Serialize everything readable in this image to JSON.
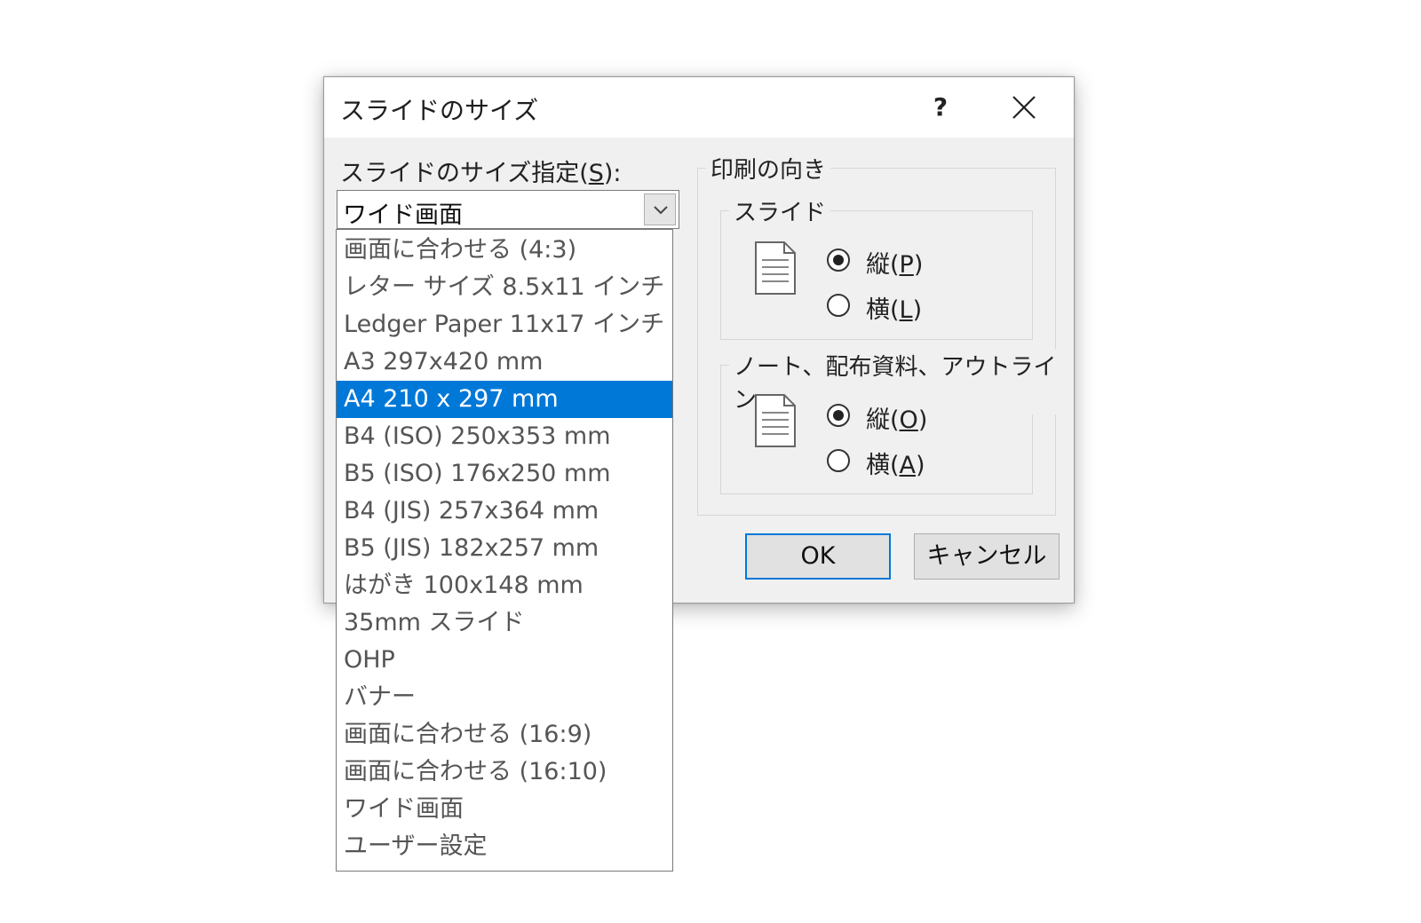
{
  "dialog": {
    "title": "スライドのサイズ",
    "help_label": "?",
    "size_label": {
      "before": "スライドのサイズ指定(",
      "key": "S",
      "after": "):"
    },
    "combo_value": "ワイド画面",
    "orientation_group": "印刷の向き",
    "slide_group": "スライド",
    "slide_portrait": {
      "before": "縦(",
      "key": "P",
      "after": ")"
    },
    "slide_landscape": {
      "before": "横(",
      "key": "L",
      "after": ")"
    },
    "notes_group": "ノート、配布資料、アウトライン",
    "notes_portrait": {
      "before": "縦(",
      "key": "O",
      "after": ")"
    },
    "notes_landscape": {
      "before": "横(",
      "key": "A",
      "after": ")"
    },
    "ok_label": "OK",
    "cancel_label": "キャンセル"
  },
  "dropdown": {
    "selected_index": 4,
    "items": [
      "画面に合わせる (4:3)",
      "レター サイズ 8.5x11 インチ",
      "Ledger Paper 11x17 インチ",
      "A3 297x420 mm",
      "A4 210 x 297 mm",
      "B4 (ISO) 250x353 mm",
      "B5 (ISO) 176x250 mm",
      "B4 (JIS) 257x364 mm",
      "B5 (JIS) 182x257 mm",
      "はがき 100x148 mm",
      "35mm スライド",
      "OHP",
      "バナー",
      "画面に合わせる (16:9)",
      "画面に合わせる (16:10)",
      "ワイド画面",
      "ユーザー設定"
    ]
  },
  "colors": {
    "accent": "#0078d7",
    "dialog_bg": "#f0f0f0"
  }
}
